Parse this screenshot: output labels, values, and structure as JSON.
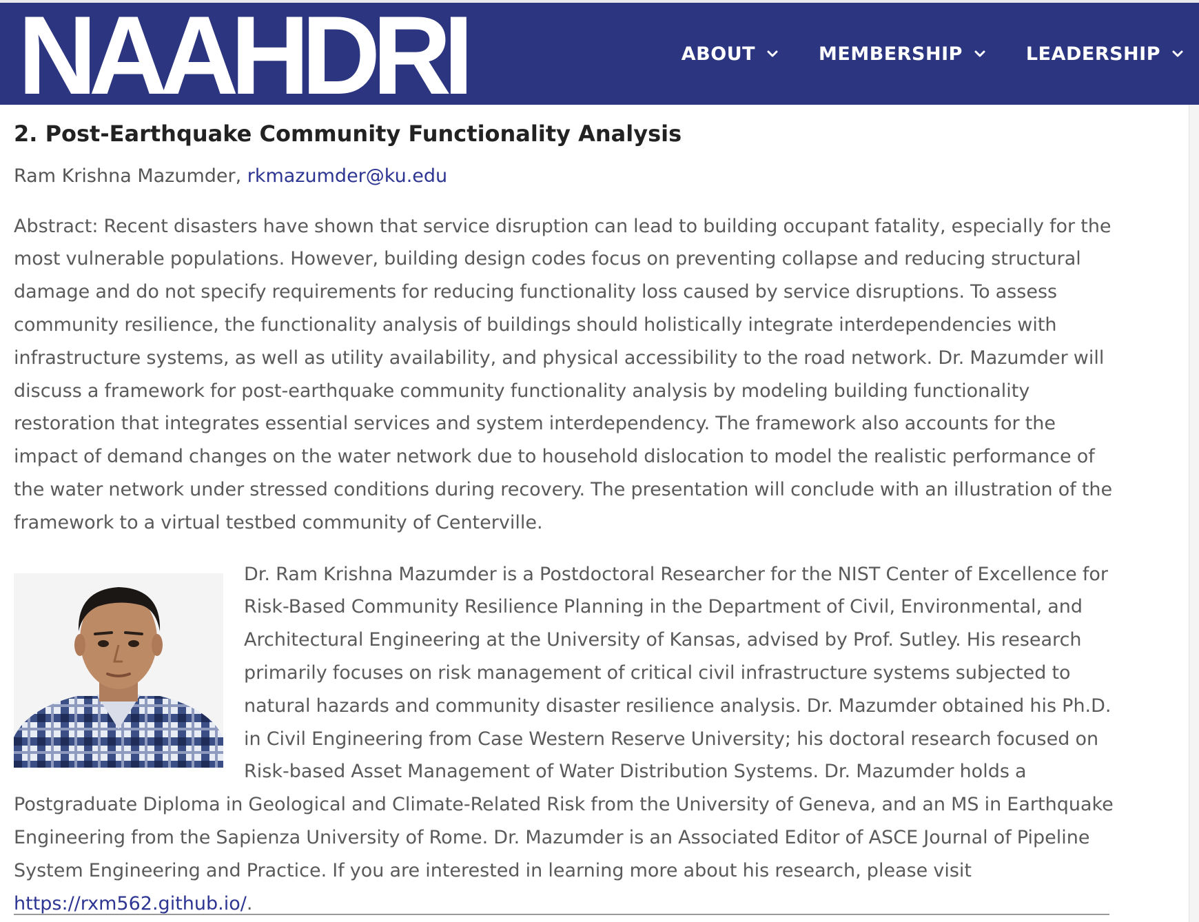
{
  "header": {
    "logo_text": "NAAHDRI",
    "nav": [
      {
        "label": "ABOUT"
      },
      {
        "label": "MEMBERSHIP"
      },
      {
        "label": "LEADERSHIP"
      }
    ]
  },
  "talk": {
    "title": "2. Post-Earthquake Community Functionality Analysis",
    "author": "Ram Krishna Mazumder, ",
    "email": "rkmazumder@ku.edu",
    "abstract": "Abstract: Recent disasters have shown that service disruption can lead to building occupant fatality, especially for the most vulnerable populations. However, building design codes focus on preventing collapse and reducing structural damage and do not specify requirements for reducing functionality loss caused by service disruptions. To assess community resilience, the functionality analysis of buildings should holistically integrate interdependencies with infrastructure systems, as well as utility availability, and physical accessibility to the road network. Dr. Mazumder will discuss a framework for post-earthquake community functionality analysis by modeling building functionality restoration that integrates essential services and system interdependency. The framework also accounts for the impact of demand changes on the water network due to household dislocation to model the realistic performance of the water network under stressed conditions during recovery. The presentation will conclude with an illustration of the framework to a virtual testbed community of Centerville.",
    "bio_text": "Dr. Ram Krishna Mazumder is a Postdoctoral Researcher for the NIST Center of Excellence for Risk-Based Community Resilience Planning in the Department of Civil, Environmental, and Architectural Engineering at the University of Kansas, advised by Prof. Sutley. His research primarily focuses on risk management of critical civil infrastructure systems subjected to natural hazards and community disaster resilience analysis. Dr. Mazumder obtained his Ph.D. in Civil Engineering from Case Western Reserve University; his doctoral research focused on Risk-based Asset Management of Water Distribution Systems. Dr. Mazumder holds a Postgraduate Diploma in Geological and Climate-Related Risk from the University of Geneva, and an MS in Earthquake Engineering from the Sapienza University of Rome. Dr. Mazumder is an Associated Editor of ASCE Journal of Pipeline System Engineering and Practice. If you are interested in learning more about his research, please visit ",
    "bio_link": "https://rxm562.github.io/",
    "bio_end": "."
  },
  "colors": {
    "header_bg": "#2c3580",
    "link": "#2d3592",
    "body_text": "#5a5a5a",
    "title_text": "#222222"
  },
  "icons": {
    "nav_dropdown": "chevron-down-icon"
  }
}
